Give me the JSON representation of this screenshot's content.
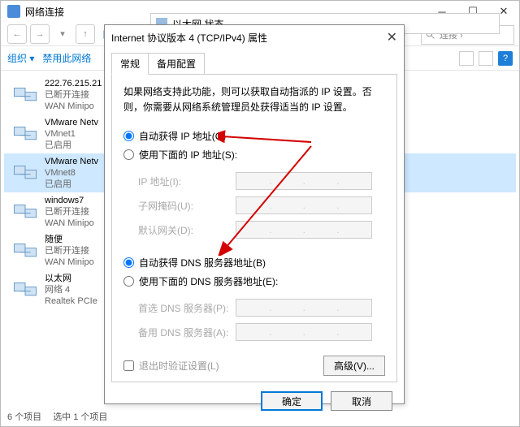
{
  "bg": {
    "title": "网络连接",
    "breadcrumb_icon": "network-icon",
    "ctrls": {
      "min": "─",
      "max": "☐",
      "close": "✕"
    },
    "cmdbar": {
      "organize": "组织 ▾",
      "disable": "禁用此网络",
      "view_icons": [
        "list-icon",
        "detail-icon"
      ],
      "help": "?"
    },
    "search_placeholder": "连接 ›",
    "status": {
      "count": "6 个项目",
      "selected": "选中 1 个项目"
    }
  },
  "ghost": {
    "title": "以太网  状态",
    "close": "✕"
  },
  "connections": [
    {
      "t1": "222.76.215.21",
      "t2": "已断开连接",
      "t3": "WAN Minipo"
    },
    {
      "t1": "VMware Netv",
      "t2": "VMnet1",
      "t3": "已启用"
    },
    {
      "t1": "VMware Netv",
      "t2": "VMnet8",
      "t3": "已启用",
      "selected": true
    },
    {
      "t1": "windows7",
      "t2": "已断开连接",
      "t3": "WAN Minipo"
    },
    {
      "t1": "随便",
      "t2": "已断开连接",
      "t3": "WAN Minipo"
    },
    {
      "t1": "以太网",
      "t2": "网络 4",
      "t3": "Realtek PCIe"
    }
  ],
  "dialog": {
    "title": "Internet 协议版本 4 (TCP/IPv4) 属性",
    "tabs": [
      "常规",
      "备用配置"
    ],
    "description": "如果网络支持此功能，则可以获取自动指派的 IP 设置。否则，你需要从网络系统管理员处获得适当的 IP 设置。",
    "ip_auto": "自动获得 IP 地址(O)",
    "ip_manual": "使用下面的 IP 地址(S):",
    "ip_fields": {
      "addr": "IP 地址(I):",
      "mask": "子网掩码(U):",
      "gw": "默认网关(D):"
    },
    "dns_auto": "自动获得 DNS 服务器地址(B)",
    "dns_manual": "使用下面的 DNS 服务器地址(E):",
    "dns_fields": {
      "pref": "首选 DNS 服务器(P):",
      "alt": "备用 DNS 服务器(A):"
    },
    "validate": "退出时验证设置(L)",
    "advanced": "高级(V)...",
    "ok": "确定",
    "cancel": "取消"
  }
}
